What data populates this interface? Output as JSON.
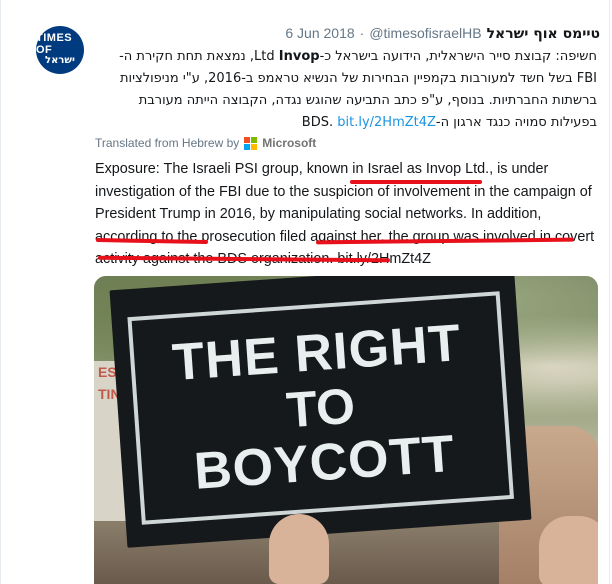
{
  "tweet": {
    "avatar_line1": "TIMES OF",
    "avatar_line2": "ישראל",
    "display_name": "טיימס אוף ישראל",
    "handle": "@timesofisraelHB",
    "separator": "·",
    "date": "6 Jun 2018",
    "hebrew_line1_a": "חשיפה: קבוצת סייר הישראלית, הידועה בישראל כ-Ltd ",
    "hebrew_line1_b": "Invop",
    "hebrew_line1_c": ", נמצאת תחת חקירת ה-",
    "hebrew_line2": "FBI בשל חשד למעורבות בקמפיין הבחירות של הנשיא טראמפ ב-2016, ע\"י מניפולציות",
    "hebrew_line3": "ברשתות החברתיות. בנוסף, ע\"פ כתב התביעה שהוגש נגדה, הקבוצה הייתה מעורבת",
    "hebrew_line4_a": "בפעילות סמויה כנגד ארגון ה-BDS. ",
    "hebrew_line4_link": "bit.ly/2HmZt4Z",
    "translated_label": "Translated from Hebrew by",
    "translator": "Microsoft",
    "english_text_a": "Exposure: The Israeli PSI group, known in Israel as Invop Ltd., is under investigation of the FBI due to the suspicion of involvement in the campaign of President Trump in 2016, by manipulating social networks. In addition, according to the prosecution filed against her, the group was involved in covert activity against the BDS organization. ",
    "english_link": "bit.ly/2HmZt4Z"
  },
  "photo": {
    "sign_line1": "THE RIGHT",
    "sign_line2": "TO",
    "sign_line3": "BOYCOTT",
    "left_sign_text": "ES\nTIN"
  },
  "colors": {
    "avatar_bg": "#003b7f",
    "link": "#1b95e0",
    "underline": "#e8101a",
    "ms_red": "#f25022",
    "ms_green": "#7fba00",
    "ms_blue": "#00a4ef",
    "ms_yellow": "#ffb900"
  }
}
